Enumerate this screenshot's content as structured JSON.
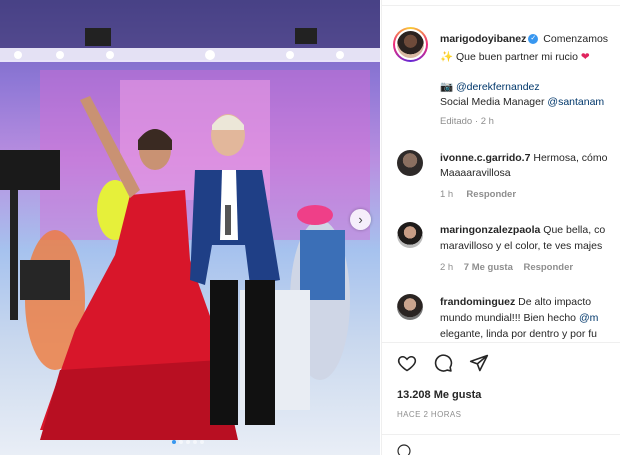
{
  "post": {
    "author": "marigodoyibanez",
    "caption_start": "Comenzamos",
    "caption_line2": "Que buen partner mi rucio",
    "mention": "@derekfernandez",
    "credit_prefix": "Social Media Manager",
    "credit_mention": "@santanam",
    "edited": "Editado",
    "edited_age": "2 h",
    "likes": "13.208 Me gusta",
    "posted": "HACE 2 HORAS"
  },
  "comments": [
    {
      "user": "ivonne.c.garrido.7",
      "line1": "Hermosa, cómo",
      "line2": "Maaaaravillosa",
      "age": "1 h",
      "likes": "",
      "reply": "Responder"
    },
    {
      "user": "maringonzalezpaola",
      "line1": "Que bella, co",
      "line2": "maravilloso y el color, te ves majes",
      "age": "2 h",
      "likes": "7 Me gusta",
      "reply": "Responder"
    },
    {
      "user": "frandominguez",
      "line1": "De alto impacto",
      "line2": "mundo mundial!!! Bien hecho",
      "line2_mention": "@m",
      "line3": "elegante, linda por dentro y por fu"
    }
  ],
  "icons": {
    "verified": "verified-badge-icon",
    "like": "heart-icon",
    "comment": "comment-icon",
    "share": "send-icon",
    "next": "chevron-right-icon"
  },
  "colors": {
    "accent": "#3897f0",
    "link": "#00376b",
    "muted": "#8e8e8e",
    "dress": "#d8162a"
  },
  "carousel": {
    "count": 5,
    "active": 1
  }
}
